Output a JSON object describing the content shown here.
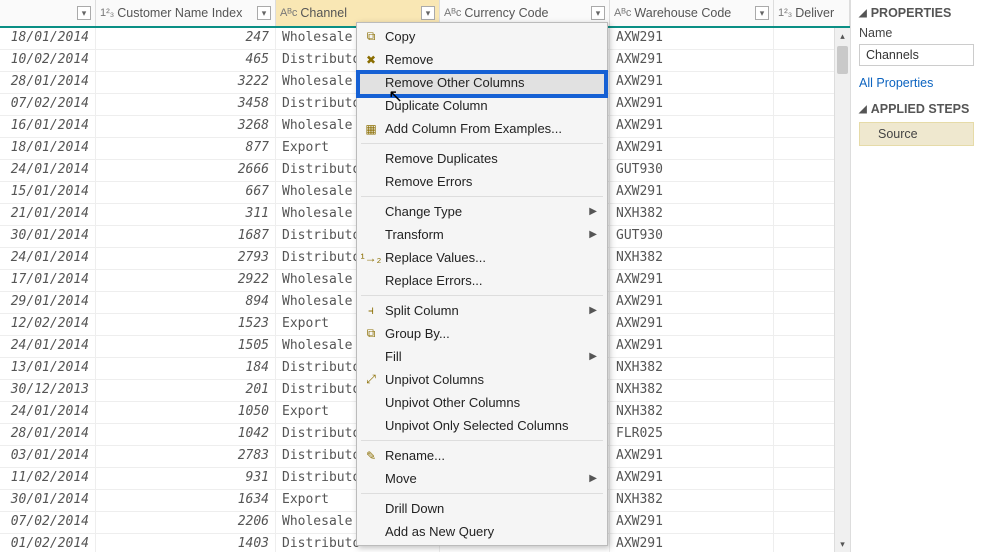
{
  "columns": {
    "e_type": "",
    "cni_type": "1²₃",
    "cni_name": "Customer Name Index",
    "ch_type": "Aᴮc",
    "ch_name": "Channel",
    "cc_type": "Aᴮc",
    "cc_name": "Currency Code",
    "wc_type": "Aᴮc",
    "wc_name": "Warehouse Code",
    "del_type": "1²₃",
    "del_name": "Deliver"
  },
  "rows": [
    {
      "e": "18/01/2014",
      "cni": "247",
      "ch": "Wholesale",
      "wc": "AXW291"
    },
    {
      "e": "10/02/2014",
      "cni": "465",
      "ch": "Distributo",
      "wc": "AXW291"
    },
    {
      "e": "28/01/2014",
      "cni": "3222",
      "ch": "Wholesale",
      "wc": "AXW291"
    },
    {
      "e": "07/02/2014",
      "cni": "3458",
      "ch": "Distributo",
      "wc": "AXW291"
    },
    {
      "e": "16/01/2014",
      "cni": "3268",
      "ch": "Wholesale",
      "wc": "AXW291"
    },
    {
      "e": "18/01/2014",
      "cni": "877",
      "ch": "Export",
      "wc": "AXW291"
    },
    {
      "e": "24/01/2014",
      "cni": "2666",
      "ch": "Distributo",
      "wc": "GUT930"
    },
    {
      "e": "15/01/2014",
      "cni": "667",
      "ch": "Wholesale",
      "wc": "AXW291"
    },
    {
      "e": "21/01/2014",
      "cni": "311",
      "ch": "Wholesale",
      "wc": "NXH382"
    },
    {
      "e": "30/01/2014",
      "cni": "1687",
      "ch": "Distributo",
      "wc": "GUT930"
    },
    {
      "e": "24/01/2014",
      "cni": "2793",
      "ch": "Distributo",
      "wc": "NXH382"
    },
    {
      "e": "17/01/2014",
      "cni": "2922",
      "ch": "Wholesale",
      "wc": "AXW291"
    },
    {
      "e": "29/01/2014",
      "cni": "894",
      "ch": "Wholesale",
      "wc": "AXW291"
    },
    {
      "e": "12/02/2014",
      "cni": "1523",
      "ch": "Export",
      "wc": "AXW291"
    },
    {
      "e": "24/01/2014",
      "cni": "1505",
      "ch": "Wholesale",
      "wc": "AXW291"
    },
    {
      "e": "13/01/2014",
      "cni": "184",
      "ch": "Distributo",
      "wc": "NXH382"
    },
    {
      "e": "30/12/2013",
      "cni": "201",
      "ch": "Distributo",
      "wc": "NXH382"
    },
    {
      "e": "24/01/2014",
      "cni": "1050",
      "ch": "Export",
      "wc": "NXH382"
    },
    {
      "e": "28/01/2014",
      "cni": "1042",
      "ch": "Distributo",
      "wc": "FLR025"
    },
    {
      "e": "03/01/2014",
      "cni": "2783",
      "ch": "Distributo",
      "wc": "AXW291"
    },
    {
      "e": "11/02/2014",
      "cni": "931",
      "ch": "Distributo",
      "wc": "AXW291"
    },
    {
      "e": "30/01/2014",
      "cni": "1634",
      "ch": "Export",
      "wc": "NXH382"
    },
    {
      "e": "07/02/2014",
      "cni": "2206",
      "ch": "Wholesale",
      "wc": "AXW291"
    },
    {
      "e": "01/02/2014",
      "cni": "1403",
      "ch": "Distributo",
      "wc": "AXW291"
    }
  ],
  "context_menu": {
    "copy": "Copy",
    "remove": "Remove",
    "remove_other": "Remove Other Columns",
    "duplicate": "Duplicate Column",
    "add_from_examples": "Add Column From Examples...",
    "remove_duplicates": "Remove Duplicates",
    "remove_errors": "Remove Errors",
    "change_type": "Change Type",
    "transform": "Transform",
    "replace_values": "Replace Values...",
    "replace_errors": "Replace Errors...",
    "split_column": "Split Column",
    "group_by": "Group By...",
    "fill": "Fill",
    "unpivot_columns": "Unpivot Columns",
    "unpivot_other": "Unpivot Other Columns",
    "unpivot_selected": "Unpivot Only Selected Columns",
    "rename": "Rename...",
    "move": "Move",
    "drill_down": "Drill Down",
    "add_as_new_query": "Add as New Query"
  },
  "properties": {
    "section_title": "PROPERTIES",
    "name_label": "Name",
    "name_value": "Channels",
    "all_properties": "All Properties"
  },
  "applied_steps": {
    "section_title": "APPLIED STEPS",
    "source": "Source"
  }
}
